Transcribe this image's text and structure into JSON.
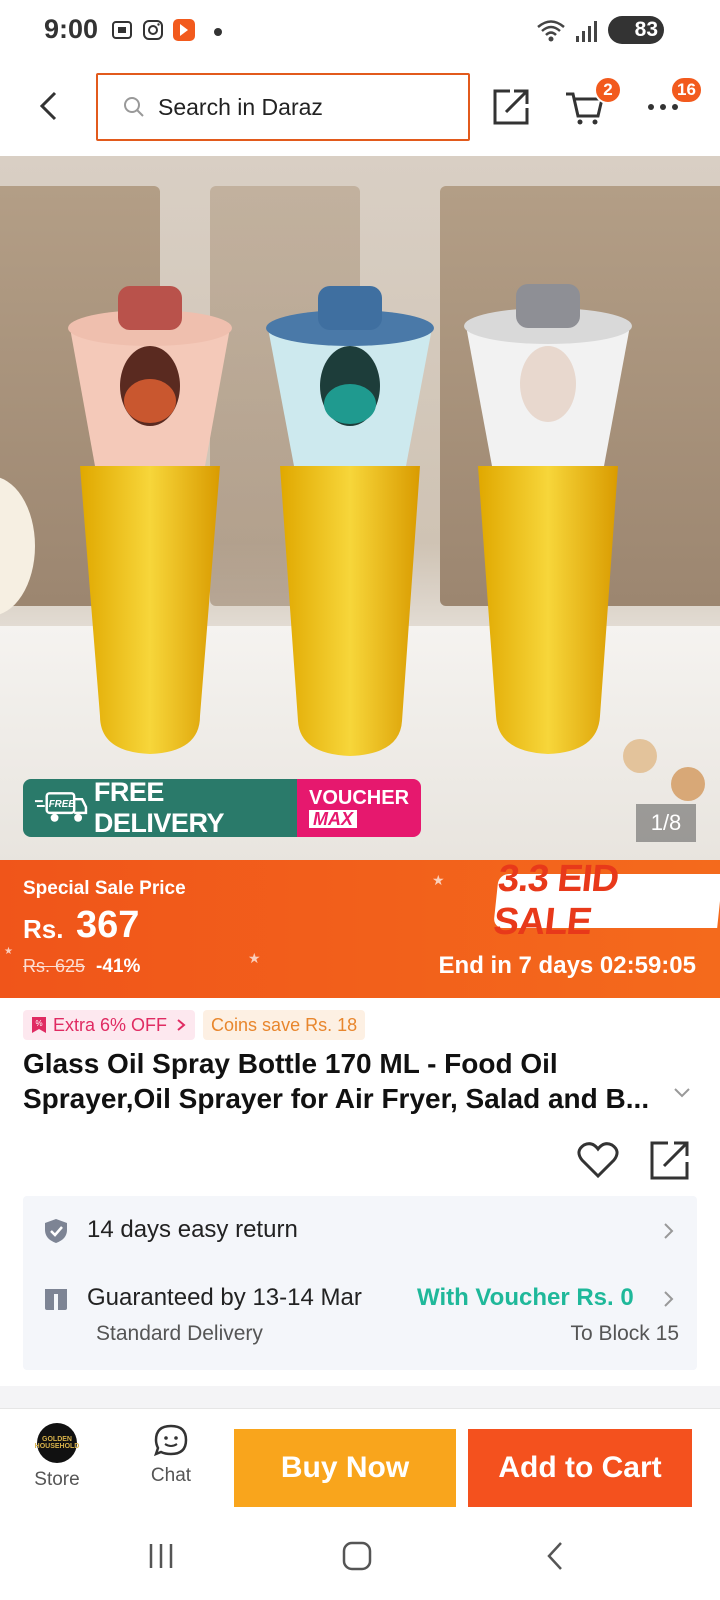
{
  "status_bar": {
    "time": "9:00",
    "battery": "83"
  },
  "header": {
    "search_placeholder": "Search in Daraz",
    "cart_badge": "2",
    "more_badge": "16"
  },
  "gallery": {
    "free_delivery": "FREE DELIVERY",
    "free_tag": "FREE",
    "voucher_line1": "VOUCHER",
    "voucher_line2": "MAX",
    "counter": "1/8"
  },
  "price": {
    "label": "Special Sale Price",
    "currency": "Rs.",
    "amount": "367",
    "original": "Rs. 625",
    "discount": "-41%",
    "campaign": "3.3 EID SALE",
    "countdown": "End in 7 days 02:59:05"
  },
  "offers": {
    "extra": "Extra 6% OFF",
    "coins": "Coins save Rs. 18"
  },
  "product": {
    "title": "Glass Oil Spray Bottle 170 ML - Food Oil Sprayer,Oil Sprayer for Air Fryer, Salad and B..."
  },
  "service": {
    "return": "14 days easy return",
    "guarantee": "Guaranteed by 13-14 Mar",
    "voucher": "With Voucher Rs. 0",
    "delivery_type": "Standard Delivery",
    "location": "To Block 15"
  },
  "actions": {
    "store": "Store",
    "store_logo": "GOLDEN HOUSEHOLD",
    "chat": "Chat",
    "buy_now": "Buy Now",
    "add_to_cart": "Add to Cart"
  },
  "colors": {
    "brand_orange": "#f4511e",
    "buy_yellow": "#f9a51c",
    "voucher_green": "#1fb89a"
  }
}
